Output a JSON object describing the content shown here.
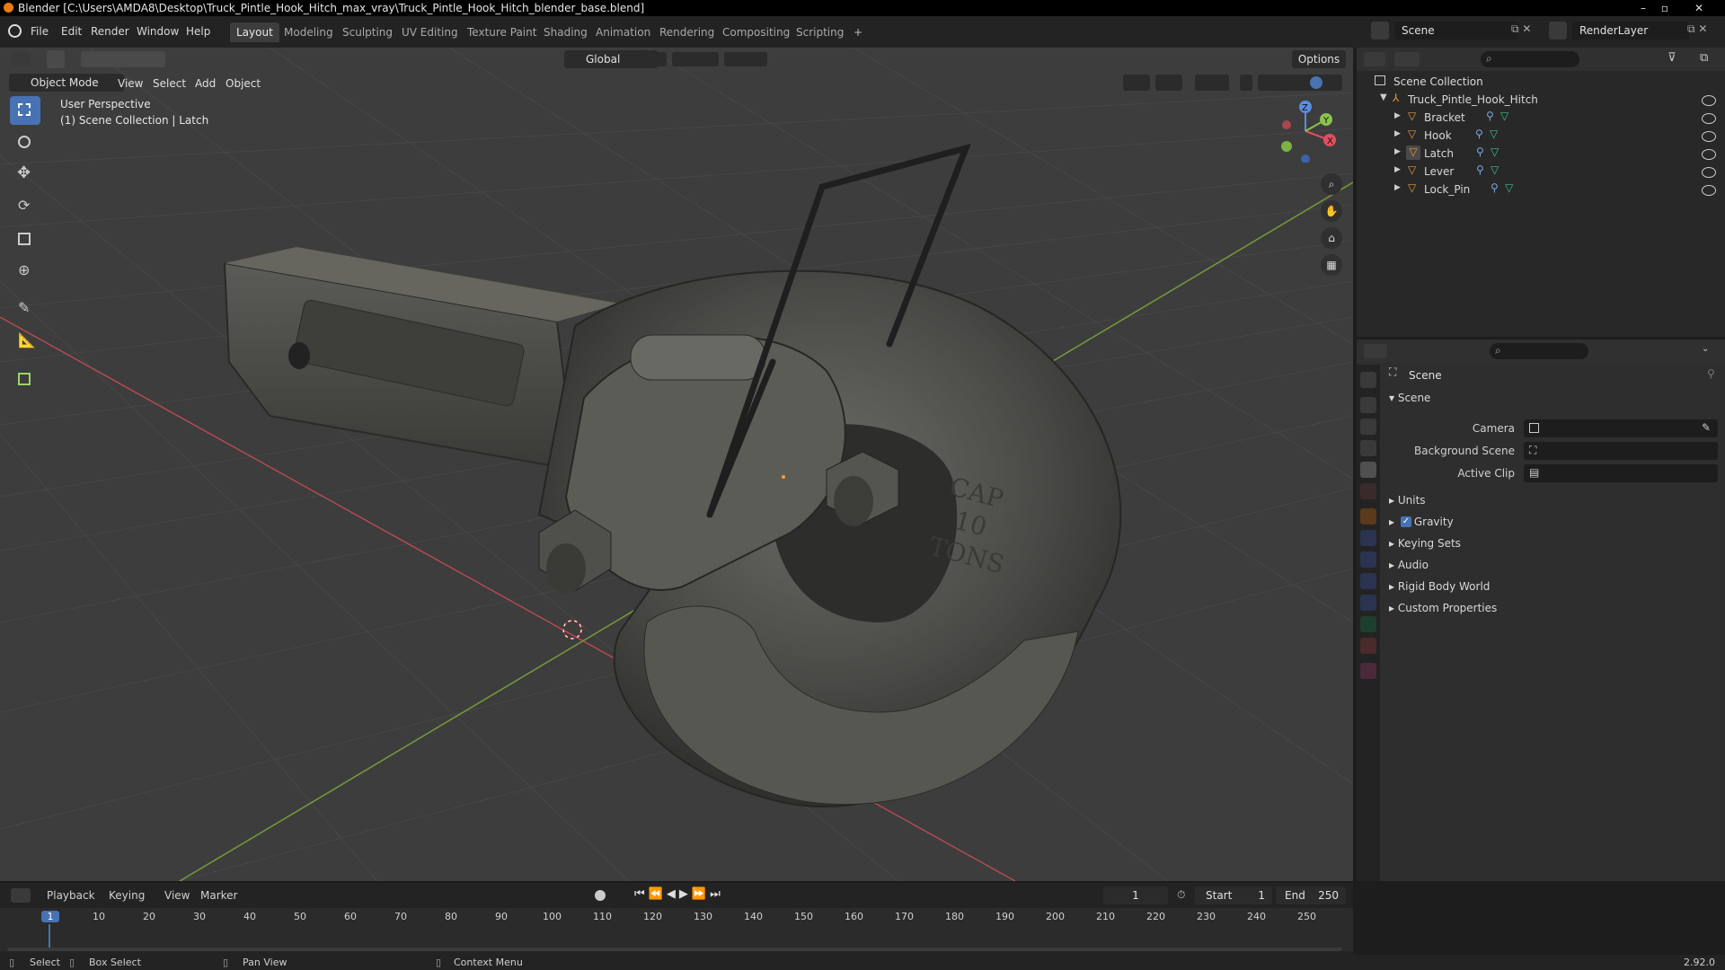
{
  "window": {
    "title": "Blender [C:\\Users\\AMDA8\\Desktop\\Truck_Pintle_Hook_Hitch_max_vray\\Truck_Pintle_Hook_Hitch_blender_base.blend]"
  },
  "menu": [
    "File",
    "Edit",
    "Render",
    "Window",
    "Help"
  ],
  "workspaces": [
    "Layout",
    "Modeling",
    "Sculpting",
    "UV Editing",
    "Texture Paint",
    "Shading",
    "Animation",
    "Rendering",
    "Compositing",
    "Scripting",
    "+"
  ],
  "scene_field": "Scene",
  "renderlayer_field": "RenderLayer",
  "toolbar": {
    "orientation": "Global",
    "options": "Options"
  },
  "viewport_header": {
    "mode": "Object Mode",
    "menus": [
      "View",
      "Select",
      "Add",
      "Object"
    ]
  },
  "viewport": {
    "perspective": "User Perspective",
    "collection": "(1) Scene Collection | Latch",
    "engraving": [
      "CAP",
      "10",
      "TONS"
    ]
  },
  "outliner": {
    "root": "Scene Collection",
    "collection": "Truck_Pintle_Hook_Hitch",
    "objects": [
      "Bracket",
      "Hook",
      "Latch",
      "Lever",
      "Lock_Pin"
    ]
  },
  "properties": {
    "context": "Scene",
    "panel": "Scene",
    "fields": [
      {
        "label": "Camera"
      },
      {
        "label": "Background Scene"
      },
      {
        "label": "Active Clip"
      }
    ],
    "sections": [
      "Units",
      "Gravity",
      "Keying Sets",
      "Audio",
      "Rigid Body World",
      "Custom Properties"
    ],
    "gravity_checked": true
  },
  "timeline": {
    "menus": [
      "Playback",
      "Keying",
      "View",
      "Marker"
    ],
    "current_frame": "1",
    "start_label": "Start",
    "start": "1",
    "end_label": "End",
    "end": "250",
    "ruler": [
      "1",
      "10",
      "20",
      "30",
      "40",
      "50",
      "60",
      "70",
      "80",
      "90",
      "100",
      "110",
      "120",
      "130",
      "140",
      "150",
      "160",
      "170",
      "180",
      "190",
      "200",
      "210",
      "220",
      "230",
      "240",
      "250"
    ]
  },
  "statusbar": {
    "items": [
      "Select",
      "Box Select",
      "Pan View",
      "Context Menu"
    ],
    "version": "2.92.0"
  },
  "colors": {
    "accent": "#4772b3",
    "x_axis": "#e04e5e",
    "y_axis": "#8bc34a",
    "z_axis": "#5b8de0",
    "object_icon": "#e8963a"
  }
}
